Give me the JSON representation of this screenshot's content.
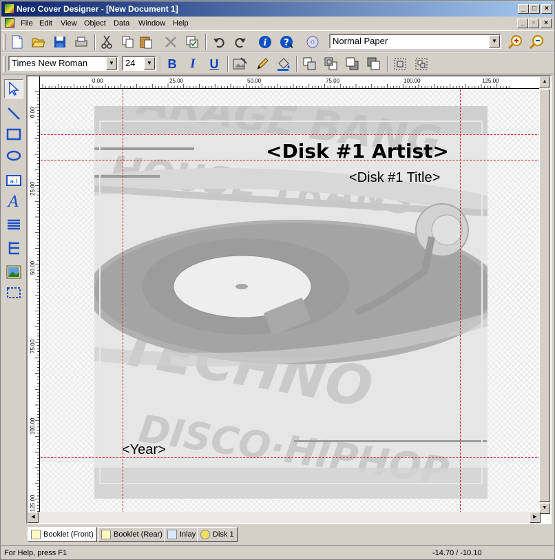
{
  "window": {
    "title": "Nero Cover Designer - [New Document 1]",
    "min": "_",
    "max": "□",
    "close": "×"
  },
  "menu": [
    "File",
    "Edit",
    "View",
    "Object",
    "Data",
    "Window",
    "Help"
  ],
  "mdi": {
    "min": "_",
    "restore": "▫",
    "close": "×"
  },
  "toolbar1": {
    "icons": [
      "new-icon",
      "open-icon",
      "save-icon",
      "print-icon",
      "cut-icon",
      "copy-icon",
      "paste-icon",
      "delete-icon",
      "properties-icon",
      "undo-icon",
      "redo-icon",
      "info-icon",
      "help-icon",
      "disc-icon",
      "zoom-in-icon",
      "zoom-out-icon"
    ],
    "paper": "Normal Paper"
  },
  "toolbar2": {
    "font": "Times New Roman",
    "size": "24",
    "bold": "B",
    "italic": "I",
    "underline": "U"
  },
  "ruler": {
    "h": [
      "0.00",
      "25.00",
      "50.00",
      "75.00",
      "100.00",
      "125.00"
    ],
    "v": [
      "0.00",
      "25.00",
      "50.00",
      "75.00",
      "100.00",
      "125.00"
    ]
  },
  "document": {
    "artist": "<Disk #1 Artist>",
    "title": "<Disk #1 Title>",
    "year": "<Year>"
  },
  "tabs": [
    {
      "label": "Booklet  (Front)"
    },
    {
      "label": "Booklet  (Rear)"
    },
    {
      "label": "Inlay"
    },
    {
      "label": "Disk 1"
    }
  ],
  "status": {
    "help": "For Help, press F1",
    "coords": "-14.70 / -10.10"
  },
  "colors": {
    "titlebar": "#0a246a",
    "guide": "#d02020",
    "tool": "#1b4fc4"
  }
}
